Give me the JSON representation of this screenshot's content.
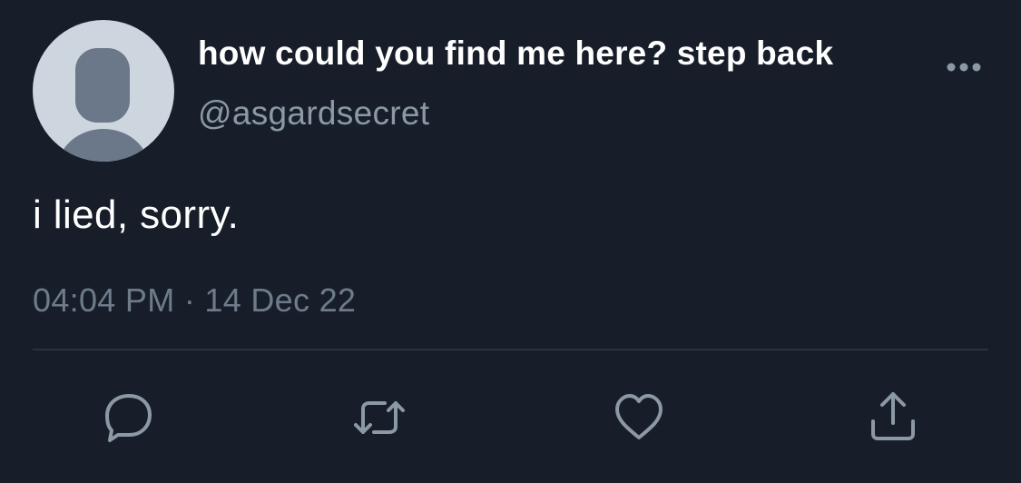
{
  "tweet": {
    "display_name": "how could you find me here? step back",
    "handle": "@asgardsecret",
    "text": "i lied, sorry.",
    "time": "04:04 PM",
    "separator": "·",
    "date": "14 Dec 22"
  },
  "icons": {
    "avatar": "default-avatar-silhouette",
    "more": "more-horizontal-icon",
    "reply": "reply-icon",
    "retweet": "retweet-icon",
    "like": "heart-icon",
    "share": "share-icon"
  },
  "colors": {
    "background": "#171e29",
    "primary_text": "#ffffff",
    "secondary_text": "#8b98a5",
    "meta_text": "#6e7b8a",
    "icon": "#8b98a5",
    "divider": "#2b333d",
    "avatar_bg": "#cdd5de",
    "avatar_fg": "#6b7889"
  }
}
